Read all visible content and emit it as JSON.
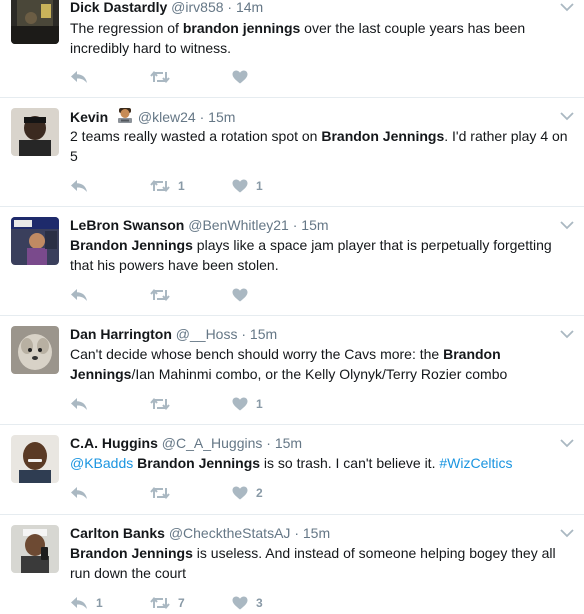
{
  "tweets": [
    {
      "name": "Dick Dastardly",
      "handle": "@irv858",
      "time": "14m",
      "segments": [
        {
          "text": "The regression of ",
          "style": "plain"
        },
        {
          "text": "brandon jennings",
          "style": "bold"
        },
        {
          "text": " over the last couple years has been incredibly hard to witness.",
          "style": "plain"
        }
      ],
      "replies": "",
      "retweets": "",
      "likes": ""
    },
    {
      "name": "Kevin",
      "has_emoji": true,
      "handle": "@klew24",
      "time": "15m",
      "segments": [
        {
          "text": "2 teams really wasted a rotation spot on ",
          "style": "plain"
        },
        {
          "text": "Brandon Jennings",
          "style": "bold"
        },
        {
          "text": ". I'd rather play 4 on 5",
          "style": "plain"
        }
      ],
      "replies": "",
      "retweets": "1",
      "likes": "1"
    },
    {
      "name": "LeBron Swanson",
      "handle": "@BenWhitley21",
      "time": "15m",
      "segments": [
        {
          "text": "Brandon Jennings",
          "style": "bold"
        },
        {
          "text": " plays like a space jam player that is perpetually forgetting that his powers have been stolen.",
          "style": "plain"
        }
      ],
      "replies": "",
      "retweets": "",
      "likes": ""
    },
    {
      "name": "Dan Harrington",
      "handle": "@__Hoss",
      "time": "15m",
      "segments": [
        {
          "text": "Can't decide whose bench should worry the Cavs more: the ",
          "style": "plain"
        },
        {
          "text": "Brandon Jennings",
          "style": "bold"
        },
        {
          "text": "/Ian Mahinmi combo, or the Kelly Olynyk/Terry Rozier combo",
          "style": "plain"
        }
      ],
      "replies": "",
      "retweets": "",
      "likes": "1"
    },
    {
      "name": "C.A. Huggins",
      "handle": "@C_A_Huggins",
      "time": "15m",
      "segments": [
        {
          "text": "@KBadds",
          "style": "link"
        },
        {
          "text": " ",
          "style": "plain"
        },
        {
          "text": "Brandon Jennings",
          "style": "bold"
        },
        {
          "text": " is so trash. I can't believe it. ",
          "style": "plain"
        },
        {
          "text": "#WizCeltics",
          "style": "link"
        }
      ],
      "replies": "",
      "retweets": "",
      "likes": "2"
    },
    {
      "name": "Carlton Banks",
      "handle": "@ChecktheStatsAJ",
      "time": "15m",
      "segments": [
        {
          "text": "Brandon Jennings",
          "style": "bold"
        },
        {
          "text": " is useless. And instead of someone helping bogey they all run down the court",
          "style": "plain"
        }
      ],
      "replies": "1",
      "retweets": "7",
      "likes": "3"
    }
  ],
  "separator": "·",
  "colors": {
    "text": "#14171a",
    "muted": "#657786",
    "action_icon": "#aab8c2",
    "link": "#1b95e0",
    "divider": "#e6ecf0"
  },
  "icons": [
    "reply-icon",
    "retweet-icon",
    "like-icon",
    "chevron-down-icon",
    "man-technologist-emoji"
  ]
}
